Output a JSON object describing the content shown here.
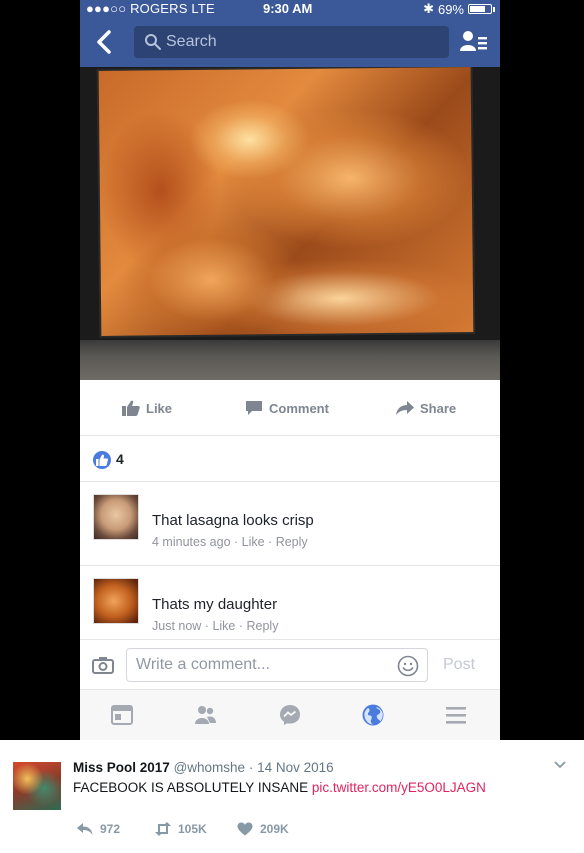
{
  "status_bar": {
    "carrier": "●●●○○ ROGERS  LTE",
    "time": "9:30 AM",
    "bluetooth": "✱",
    "battery": "69%"
  },
  "navbar": {
    "search_placeholder": "Search",
    "icons": [
      "back-arrow-icon",
      "search-icon",
      "friend-requests-icon"
    ]
  },
  "colors": {
    "facebook_blue": "#3b5998",
    "twitter_link": "#e0245e",
    "like_blue": "#4a7ce0"
  },
  "post_actions": {
    "like": "Like",
    "comment": "Comment",
    "share": "Share"
  },
  "reactions": {
    "count": "4"
  },
  "comments": [
    {
      "text": "That lasagna looks crisp",
      "time": "4 minutes ago",
      "like": "Like",
      "reply": "Reply"
    },
    {
      "text": "Thats my daughter",
      "time": "Just now",
      "like": "Like",
      "reply": "Reply"
    }
  ],
  "write_comment": {
    "placeholder": "Write a comment...",
    "post": "Post"
  },
  "tabbar": {
    "icons": [
      "news-feed-icon",
      "friends-icon",
      "messenger-icon",
      "globe-notifications-icon",
      "menu-icon"
    ],
    "active": "globe-notifications-icon"
  },
  "tweet": {
    "name": "Miss Pool 2017",
    "handle": "@whomshe",
    "date": "14 Nov 2016",
    "text": "FACEBOOK IS ABSOLUTELY INSANE",
    "link": "pic.twitter.com/yE5O0LJAGN",
    "replies": "972",
    "retweets": "105K",
    "likes": "209K"
  }
}
